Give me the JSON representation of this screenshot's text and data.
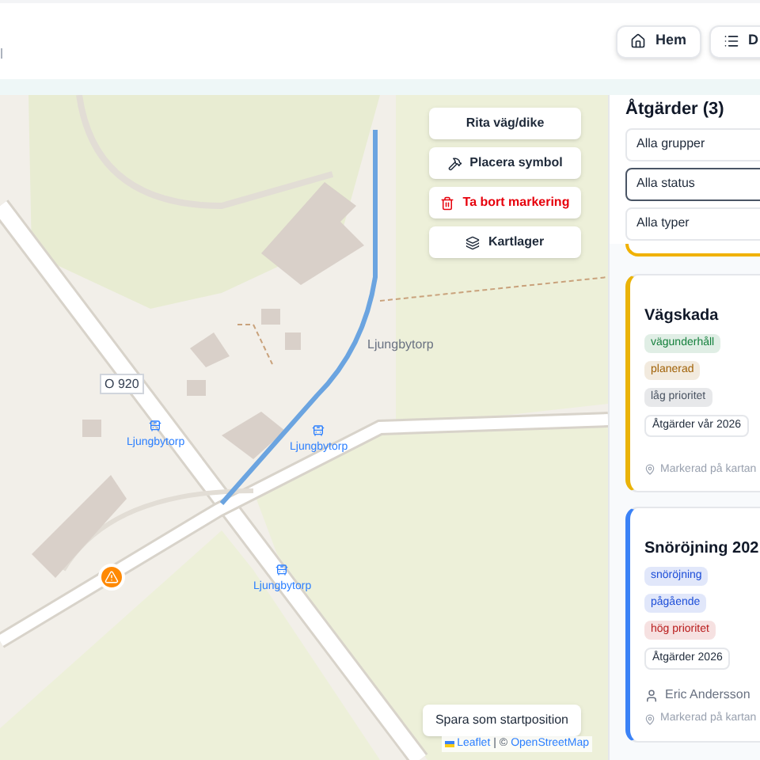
{
  "header": {
    "subtitle": "l",
    "nav": [
      {
        "label": "Hem"
      },
      {
        "label": "D"
      }
    ]
  },
  "map": {
    "tools": [
      {
        "label": "Rita väg/dike",
        "kind": "plain"
      },
      {
        "label": "Placera symbol",
        "kind": "plain"
      },
      {
        "label": "Ta bort markering",
        "kind": "danger"
      },
      {
        "label": "Kartlager",
        "kind": "plain"
      }
    ],
    "labels": [
      {
        "text": "O 920",
        "kind": "road"
      },
      {
        "text": "Ljungbytorp",
        "kind": "place"
      },
      {
        "text": "Ljungbytorp",
        "kind": "bus"
      },
      {
        "text": "Ljungbytorp",
        "kind": "bus"
      },
      {
        "text": "Ljungbytorp",
        "kind": "bus"
      }
    ],
    "save_button": "Spara som startposition",
    "attribution": {
      "leaflet": "Leaflet",
      "separator": "| ©",
      "source": "OpenStreetMap"
    }
  },
  "sidebar": {
    "title": "Åtgärder (3)",
    "filters": [
      {
        "value": "Alla grupper",
        "focused": false
      },
      {
        "value": "Alla status",
        "focused": true
      },
      {
        "value": "Alla typer",
        "focused": false
      }
    ],
    "cards": [
      {
        "title": "Vägskada",
        "color": "#eab308",
        "tags": [
          {
            "text": "vägunderhåll",
            "color": "#15803d"
          },
          {
            "text": "planerad",
            "color": "#a16207"
          },
          {
            "text": "låg prioritet",
            "color": "#4b5563"
          }
        ],
        "group": "Åtgärder vår 2026",
        "location": "Markerad på kartan"
      },
      {
        "title": "Snöröjning 202",
        "color": "#3b82f6",
        "tags": [
          {
            "text": "snöröjning",
            "color": "#1d4ed8"
          },
          {
            "text": "pågående",
            "color": "#1d4ed8"
          },
          {
            "text": "hög prioritet",
            "color": "#b91c1c"
          }
        ],
        "group": "Åtgärder 2026",
        "assignee": "Eric Andersson",
        "location": "Markerad på kartan"
      }
    ]
  }
}
